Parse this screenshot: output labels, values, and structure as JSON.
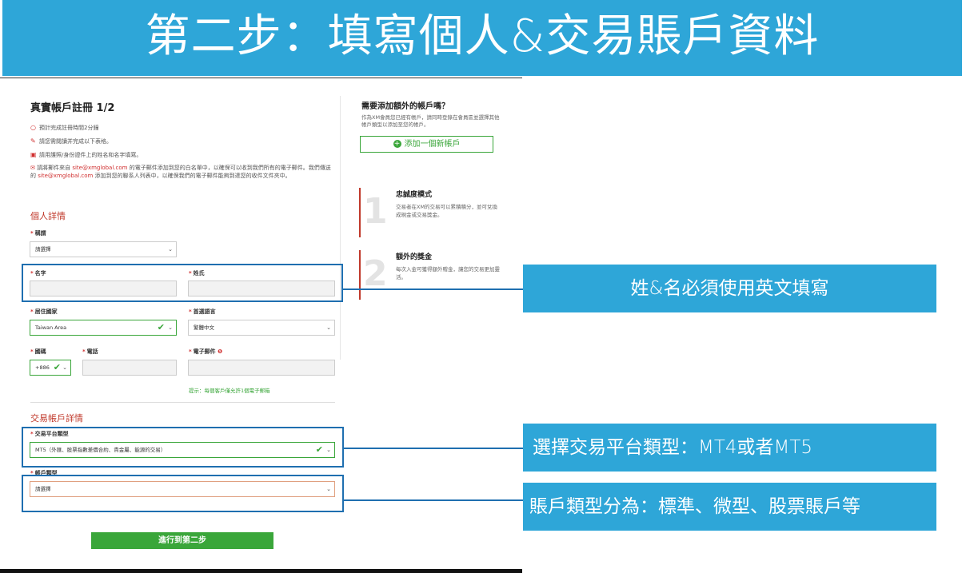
{
  "banner": {
    "title": "第二步：填寫個人&交易賬戶資料"
  },
  "form": {
    "title": "真實帳戶註冊 1/2",
    "notes": [
      "預計完成註冊時間2分鐘",
      "請您需閱讀并完成以下表格。",
      "請用護照/身份證件上的姓名和名字填寫。"
    ],
    "email_notice_a": "請將郵件來自",
    "email_a": "site@xmglobal.com",
    "email_notice_b": "的電子郵件添加到您的白名單中，以確保可以收到我們所有的電子郵件。我們傳送的",
    "email_b": "site@xmglobal.com",
    "email_notice_c": "添加到您的聯系人列表中，以確保我們的電子郵件能夠到達您的收件文件夾中。",
    "personal_section": "個人詳情",
    "title_label": "稱謂",
    "title_value": "請選擇",
    "first_name_label": "名字",
    "last_name_label": "姓氏",
    "country_label": "居住國家",
    "country_value": "Taiwan Area",
    "language_label": "首選語言",
    "language_value": "繁體中文",
    "code_label": "國碼",
    "code_value": "+886",
    "phone_label": "電話",
    "email_label": "電子郵件",
    "email_hint": "提示：每個客戶僅允許1個電子郵箱",
    "trading_section": "交易帳戶詳情",
    "platform_label": "交易平台類型",
    "platform_value": "MT5（外匯、股票指數差價合約、貴金屬、能源的交易）",
    "account_type_label": "帳戶類型",
    "account_type_value": "請選擇",
    "submit_label": "進行到第二步"
  },
  "side": {
    "title": "需要添加額外的帳戶嗎？",
    "text": "作為XM會員您已經有帳戶，請同時登錄在會員區並選擇其他帳戶類型以添加至您的帳戶。",
    "add_button": "添加一個新帳戶",
    "promo1": {
      "num": "1",
      "title": "忠誠度模式",
      "text": "交易者在XM的交易可以累積積分，並可兌換成現金或交易獎金。"
    },
    "promo2": {
      "num": "2",
      "title": "額外的獎金",
      "text": "每次入金可獲得額外贈金，讓您的交易更加靈活。"
    }
  },
  "callouts": {
    "name": "姓&名必須使用英文填寫",
    "platform": "選擇交易平台類型：MT4或者MT5",
    "account": "賬戶類型分為：標準、微型、股票賬戶等"
  },
  "colors": {
    "banner": "#2ea6d8",
    "highlight": "#1f6fb0",
    "accent_green": "#3aa63a",
    "accent_red": "#c0392b"
  }
}
